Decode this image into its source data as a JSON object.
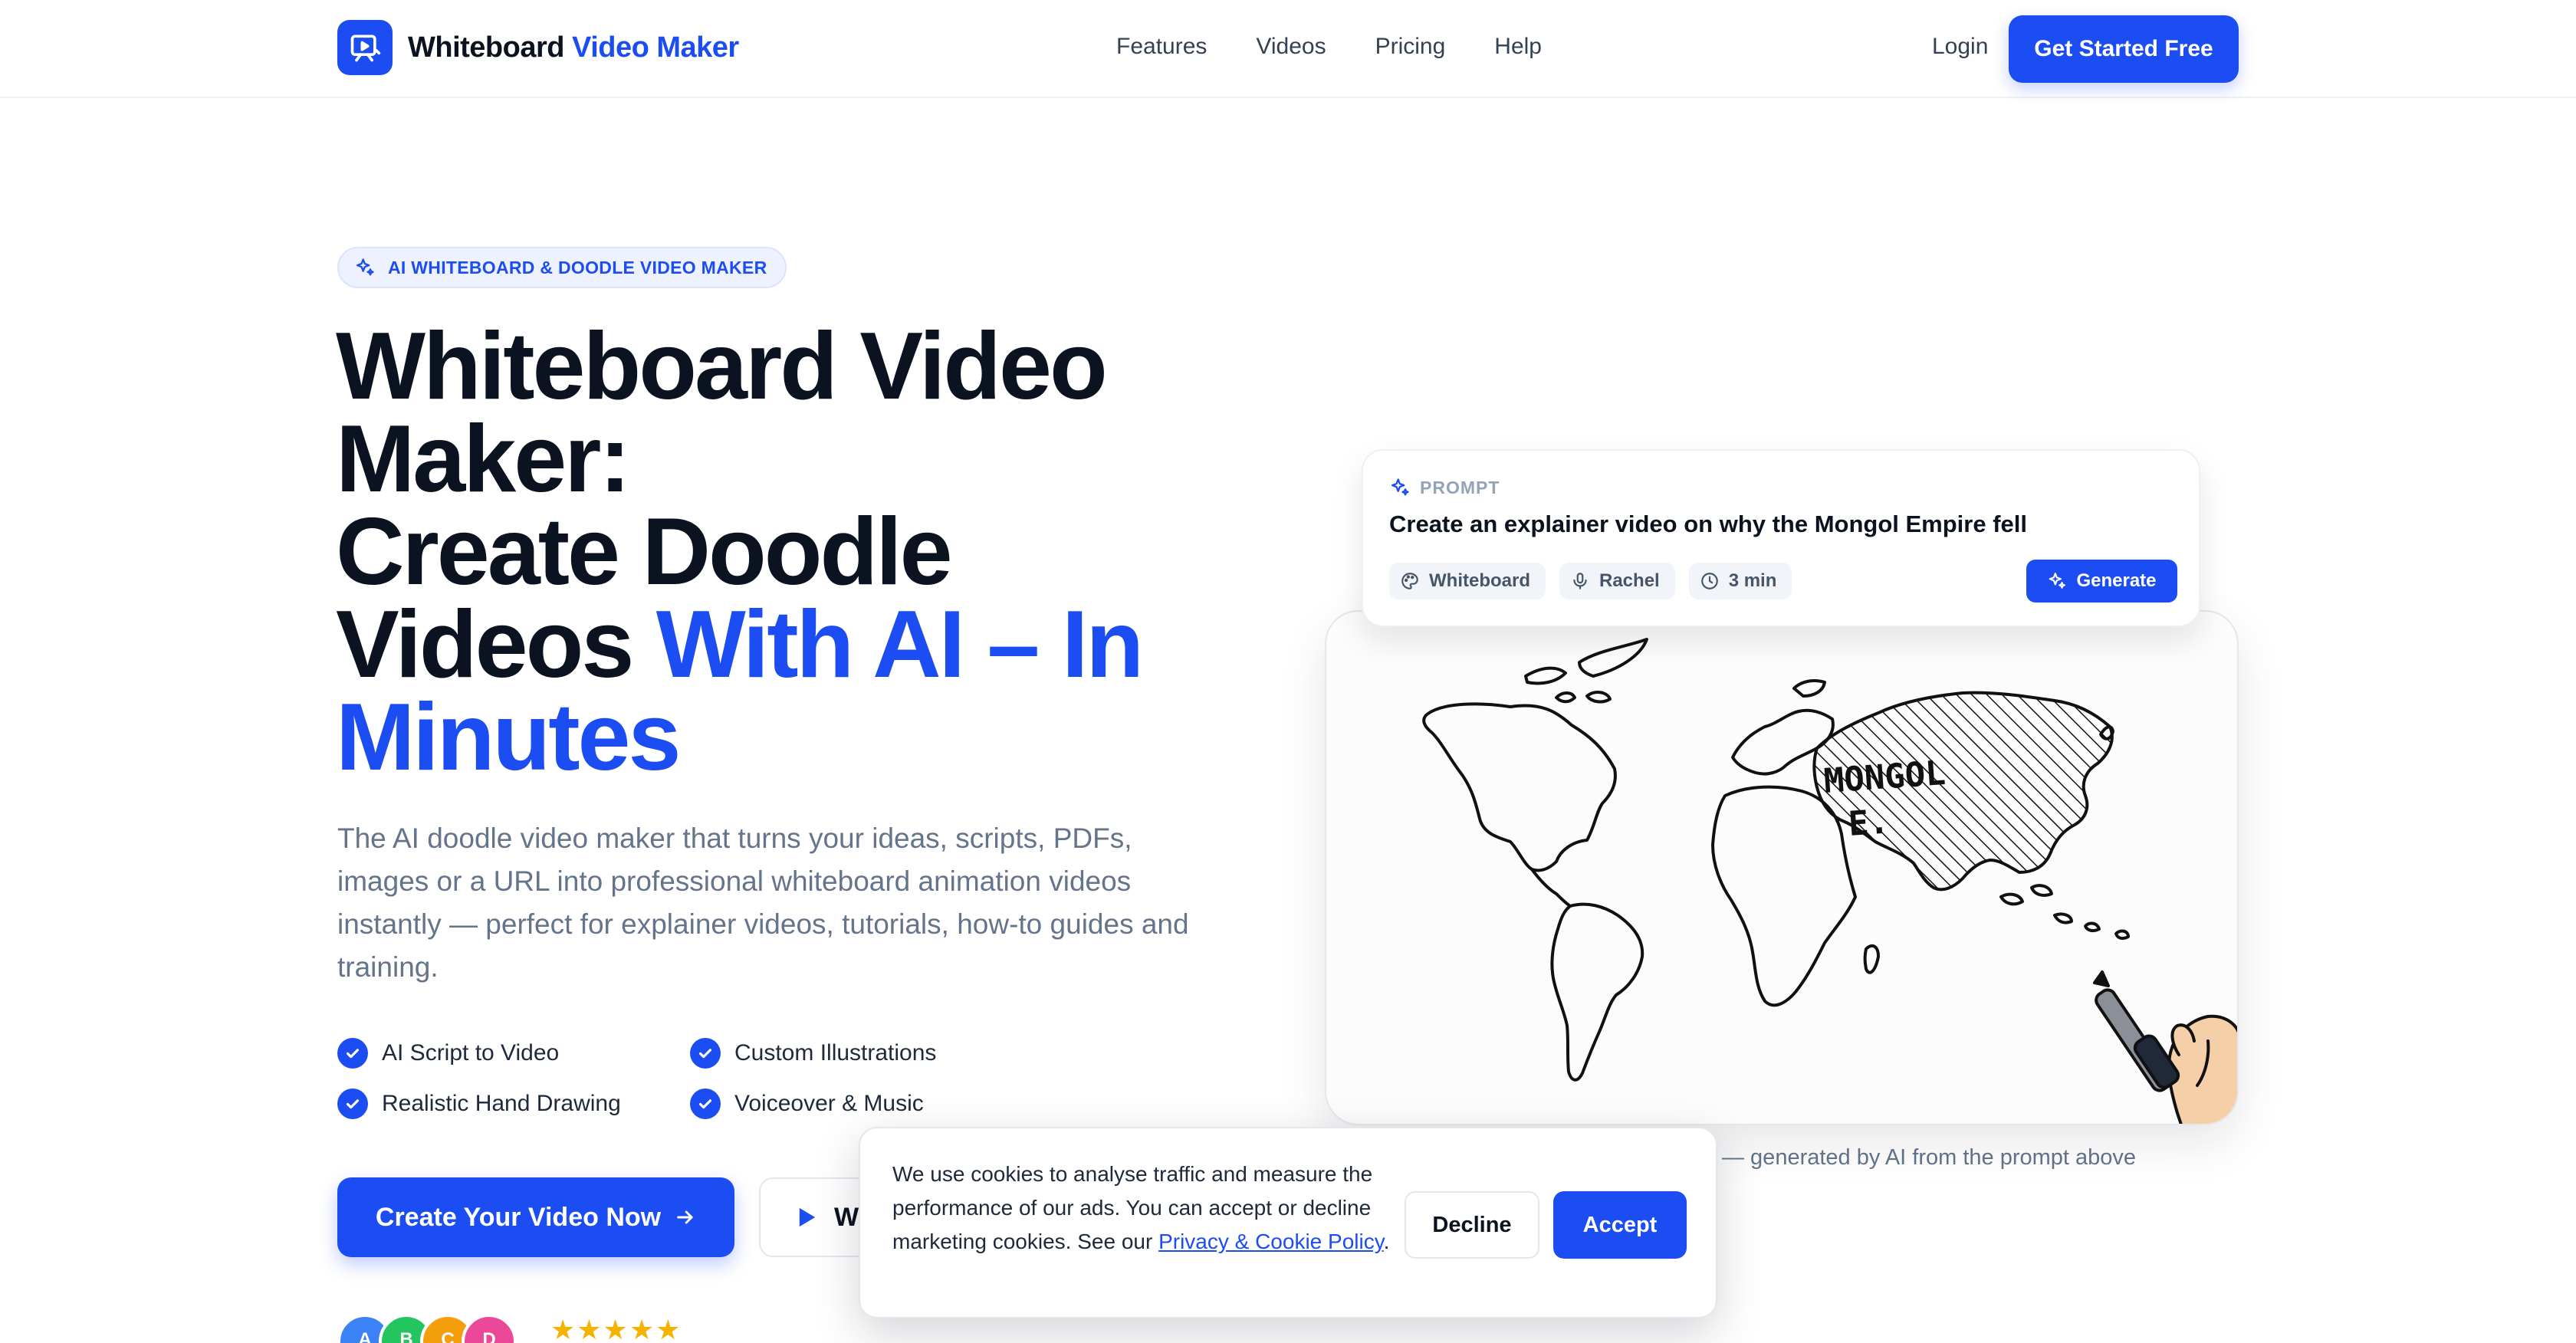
{
  "nav": {
    "logo_part1": "Whiteboard",
    "logo_part2": "Video Maker",
    "links": [
      "Features",
      "Videos",
      "Pricing",
      "Help"
    ],
    "login": "Login",
    "cta": "Get Started Free"
  },
  "hero": {
    "badge": "AI WHITEBOARD & DOODLE VIDEO MAKER",
    "headline_line1": "Whiteboard Video",
    "headline_line2": "Maker:",
    "headline_line3": "Create Doodle",
    "headline_line4_dark": "Videos",
    "headline_line4_blue": "With AI – In",
    "headline_line5_blue": "Minutes",
    "description": "The AI doodle video maker that turns your ideas, scripts, PDFs, images or a URL into professional whiteboard animation videos instantly — perfect for explainer videos, tutorials, how-to guides and training.",
    "features": [
      "AI Script to Video",
      "Custom Illustrations",
      "Realistic Hand Drawing",
      "Voiceover & Music"
    ],
    "primary_cta": "Create Your Video Now",
    "secondary_cta": "W",
    "avatars": [
      "A",
      "B",
      "C",
      "D"
    ],
    "avatar_colors": [
      "#3b82f6",
      "#22c55e",
      "#f59e0b",
      "#ec4899"
    ],
    "stars": "★★★★★"
  },
  "prompt": {
    "label": "PROMPT",
    "text": "Create an explainer video on why the Mongol Empire fell",
    "chips": [
      "Whiteboard",
      "Rachel",
      "3 min"
    ],
    "generate": "Generate"
  },
  "canvas": {
    "map_label_line1": "MONGOL",
    "map_label_line2": "E.",
    "caption": "— generated by AI from the prompt above"
  },
  "cookie": {
    "text": "We use cookies to analyse traffic and measure the performance of our ads. You can accept or decline marketing cookies. See our ",
    "link": "Privacy & Cookie Policy",
    "end": ".",
    "decline": "Decline",
    "accept": "Accept"
  },
  "colors": {
    "accent": "#1c4df2",
    "text": "#0b1220",
    "muted": "#64748b"
  }
}
